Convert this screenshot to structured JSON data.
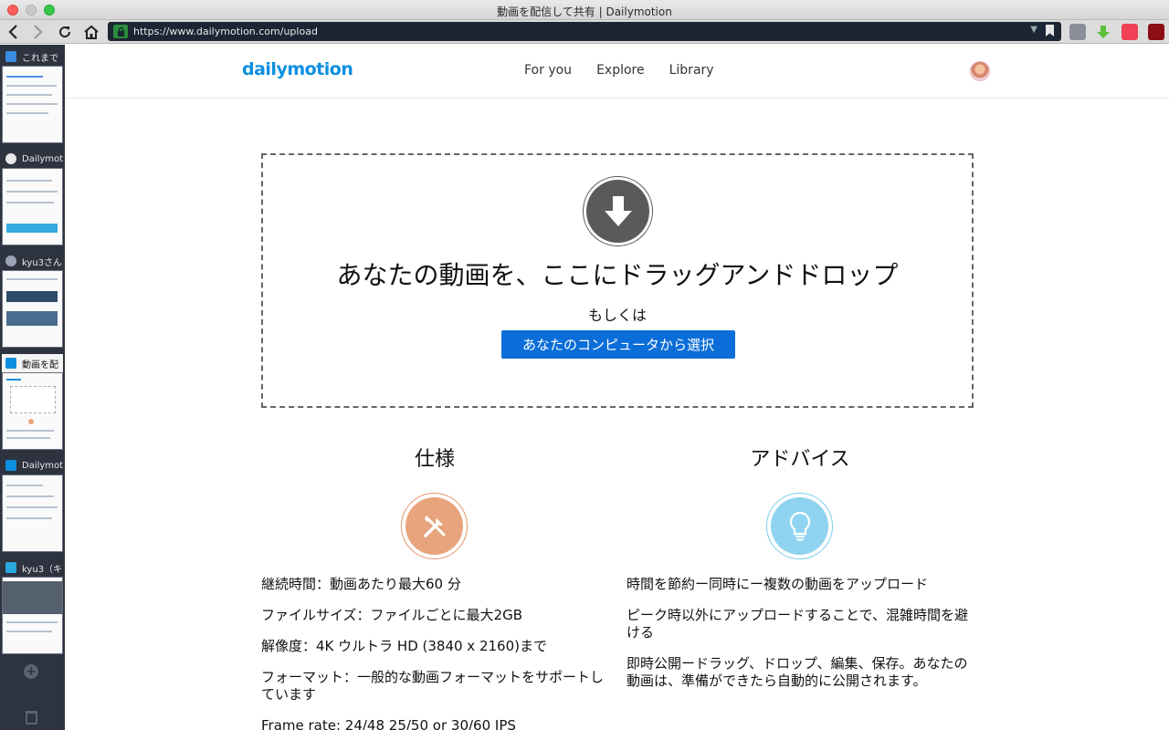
{
  "window": {
    "title": "動画を配信して共有 | Dailymotion"
  },
  "browser": {
    "url": "https://www.dailymotion.com/upload",
    "back_icon": "chevron-left-icon",
    "forward_icon": "chevron-right-icon",
    "reload_icon": "reload-icon",
    "home_icon": "home-icon"
  },
  "tabs": [
    {
      "label": "これまで",
      "favicon_color": "#3b8de0"
    },
    {
      "label": "Dailymot",
      "favicon_color": "#e8e8e8"
    },
    {
      "label": "kyu3さん",
      "favicon_color": "#9aa3b3"
    },
    {
      "label": "動画を配",
      "favicon_color": "#0d8fe0"
    },
    {
      "label": "Dailymot",
      "favicon_color": "#0d8fe0"
    },
    {
      "label": "kyu3（キ",
      "favicon_color": "#2aa9e0"
    }
  ],
  "site": {
    "logo": "dailymotion",
    "nav": [
      "For you",
      "Explore",
      "Library"
    ]
  },
  "upload": {
    "title": "あなたの動画を、ここにドラッグアンドドロップ",
    "or": "もしくは",
    "button": "あなたのコンピュータから選択"
  },
  "specs": {
    "heading": "仕様",
    "items": [
      "継続時間：動画あたり最大60 分",
      "ファイルサイズ：ファイルごとに最大2GB",
      "解像度：4K ウルトラ HD (3840 x 2160)まで",
      "フォーマット：一般的な動画フォーマットをサポートしています",
      "Frame rate: 24/48 25/50 or 30/60 IPS"
    ]
  },
  "advice": {
    "heading": "アドバイス",
    "items": [
      "時間を節約ー同時にー複数の動画をアップロード",
      "ピーク時以外にアップロードすることで、混雑時間を避ける",
      "即時公開ードラッグ、ドロップ、編集、保存。あなたの動画は、準備ができたら自動的に公開されます。"
    ]
  },
  "colors": {
    "brand": "#0d8fe0",
    "button": "#0b6ed8",
    "specs_icon": "#e8a47c",
    "advice_icon": "#8fd3f0"
  }
}
